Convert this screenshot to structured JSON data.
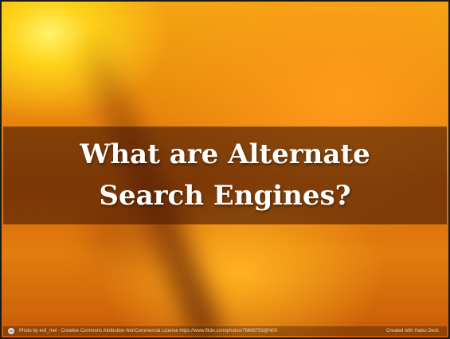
{
  "slide": {
    "title": "What are Alternate\nSearch Engines?",
    "footer": {
      "cc_icon": "cc",
      "attribution": "Photo by evil_mel - Creative Commons Attribution-NonCommercial License  https://www.flickr.com/photos/76666793@N00",
      "credit": "Created with Haiku Deck"
    }
  },
  "colors": {
    "background_primary": "#e8860c",
    "highlight": "#fff36a",
    "title_band": "#461905",
    "title_text": "#ffffff"
  },
  "icons": {
    "license": "creative-commons-icon"
  }
}
